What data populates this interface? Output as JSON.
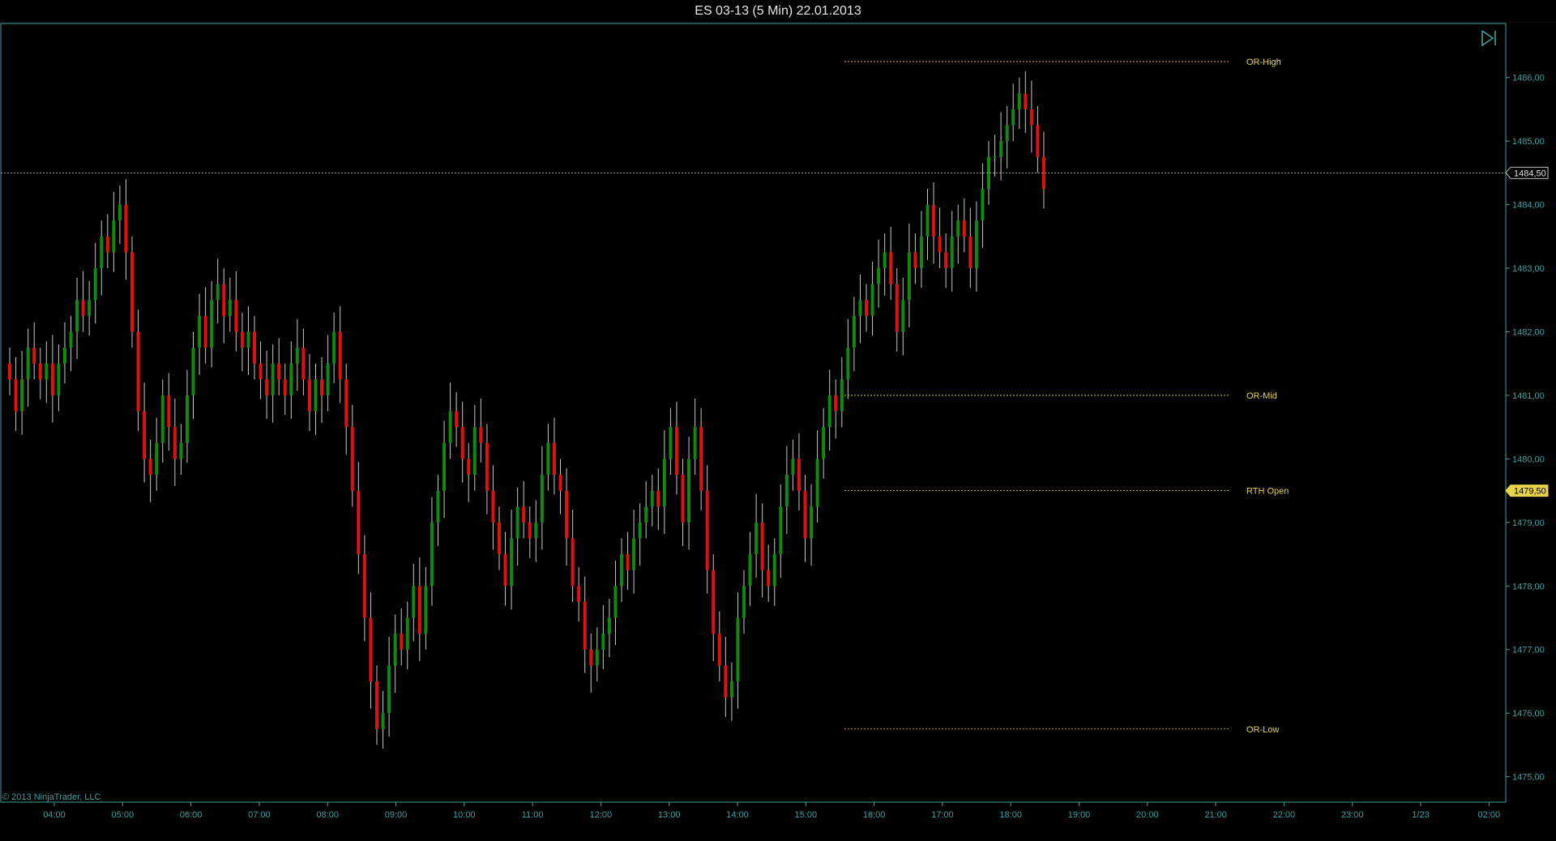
{
  "window": {
    "title": "ES 03-13 (5 Min)  22.01.2013"
  },
  "copyright": "© 2013 NinjaTrader, LLC",
  "colors": {
    "background": "#000000",
    "axis": "#3fa0a0",
    "up": "#0f8a0f",
    "down": "#e01010",
    "wick": "#c8c8c8",
    "level": "#e8d24a"
  },
  "chart_data": {
    "type": "candlestick",
    "instrument": "ES 03-13",
    "interval": "5 Min",
    "date": "22.01.2013",
    "ylim": [
      1474.6,
      1486.85
    ],
    "y_ticks": [
      "1475,00",
      "1476,00",
      "1477,00",
      "1478,00",
      "1479,00",
      "1480,00",
      "1481,00",
      "1482,00",
      "1483,00",
      "1484,00",
      "1485,00",
      "1486,00"
    ],
    "x_ticks": [
      "04:00",
      "05:00",
      "06:00",
      "07:00",
      "08:00",
      "09:00",
      "10:00",
      "11:00",
      "12:00",
      "13:00",
      "14:00",
      "15:00",
      "16:00",
      "17:00",
      "18:00",
      "19:00",
      "20:00",
      "21:00",
      "22:00",
      "23:00",
      "1/23",
      "02:00"
    ],
    "current_price": {
      "label": "1484,50",
      "value": 1484.5
    },
    "rth_open_price": {
      "label": "1479,50",
      "value": 1479.5
    },
    "levels": [
      {
        "name": "OR-High",
        "value": 1486.25
      },
      {
        "name": "OR-Mid",
        "value": 1481.0
      },
      {
        "name": "RTH Open",
        "value": 1479.5
      },
      {
        "name": "OR-Low",
        "value": 1475.75
      }
    ],
    "closes": [
      1481.25,
      1480.75,
      1481.25,
      1481.75,
      1481.5,
      1481.25,
      1481.5,
      1481.0,
      1481.5,
      1481.75,
      1482.0,
      1482.5,
      1482.25,
      1482.5,
      1483.0,
      1483.5,
      1483.25,
      1483.75,
      1484.0,
      1483.25,
      1482.0,
      1480.75,
      1480.0,
      1479.75,
      1480.25,
      1481.0,
      1480.5,
      1480.0,
      1480.25,
      1481.0,
      1481.75,
      1482.25,
      1481.75,
      1482.5,
      1482.75,
      1482.25,
      1482.5,
      1482.0,
      1481.75,
      1482.0,
      1481.5,
      1481.25,
      1481.0,
      1481.5,
      1481.25,
      1481.0,
      1481.5,
      1481.75,
      1481.25,
      1480.75,
      1481.25,
      1481.0,
      1481.5,
      1482.0,
      1481.25,
      1480.5,
      1479.5,
      1478.5,
      1477.5,
      1476.5,
      1475.75,
      1476.0,
      1476.75,
      1477.25,
      1477.0,
      1477.5,
      1478.0,
      1477.25,
      1478.0,
      1479.0,
      1479.5,
      1480.25,
      1480.75,
      1480.5,
      1480.0,
      1479.75,
      1480.5,
      1480.25,
      1479.5,
      1479.0,
      1478.5,
      1478.0,
      1478.75,
      1479.25,
      1479.0,
      1478.75,
      1479.0,
      1479.75,
      1480.25,
      1479.75,
      1479.5,
      1478.75,
      1478.0,
      1477.75,
      1477.0,
      1476.75,
      1477.0,
      1477.25,
      1477.5,
      1478.0,
      1478.5,
      1478.25,
      1478.75,
      1479.0,
      1479.25,
      1479.5,
      1479.25,
      1480.0,
      1480.5,
      1479.75,
      1479.0,
      1480.0,
      1480.5,
      1479.5,
      1478.25,
      1477.25,
      1476.75,
      1476.25,
      1476.5,
      1477.5,
      1478.0,
      1478.5,
      1479.0,
      1478.25,
      1478.0,
      1478.5,
      1479.25,
      1479.75,
      1480.0,
      1479.5,
      1478.75,
      1479.25,
      1480.0,
      1480.5,
      1481.0,
      1480.75,
      1481.25,
      1481.75,
      1482.25,
      1482.5,
      1482.25,
      1482.75,
      1483.0,
      1483.25,
      1482.75,
      1482.0,
      1482.5,
      1483.25,
      1483.0,
      1483.5,
      1484.0,
      1483.5,
      1483.25,
      1483.0,
      1483.5,
      1483.75,
      1483.5,
      1483.0,
      1483.75,
      1484.25,
      1484.75,
      1484.75,
      1485.0,
      1485.25,
      1485.5,
      1485.75,
      1485.5,
      1485.25,
      1484.75,
      1484.25
    ]
  }
}
